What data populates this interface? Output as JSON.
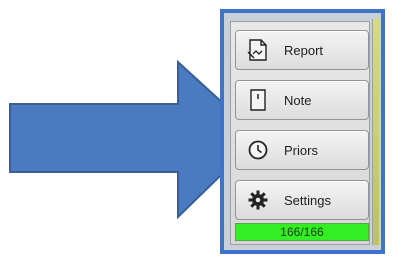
{
  "buttons": [
    {
      "label": "Report",
      "icon": "report-icon"
    },
    {
      "label": "Note",
      "icon": "note-icon"
    },
    {
      "label": "Priors",
      "icon": "clock-icon"
    },
    {
      "label": "Settings",
      "icon": "gear-icon"
    }
  ],
  "counter": {
    "text": "166/166"
  },
  "colors": {
    "arrow": "#4a7bc0",
    "panel_border": "#3f72c9",
    "counter_bg": "#33ee22"
  }
}
